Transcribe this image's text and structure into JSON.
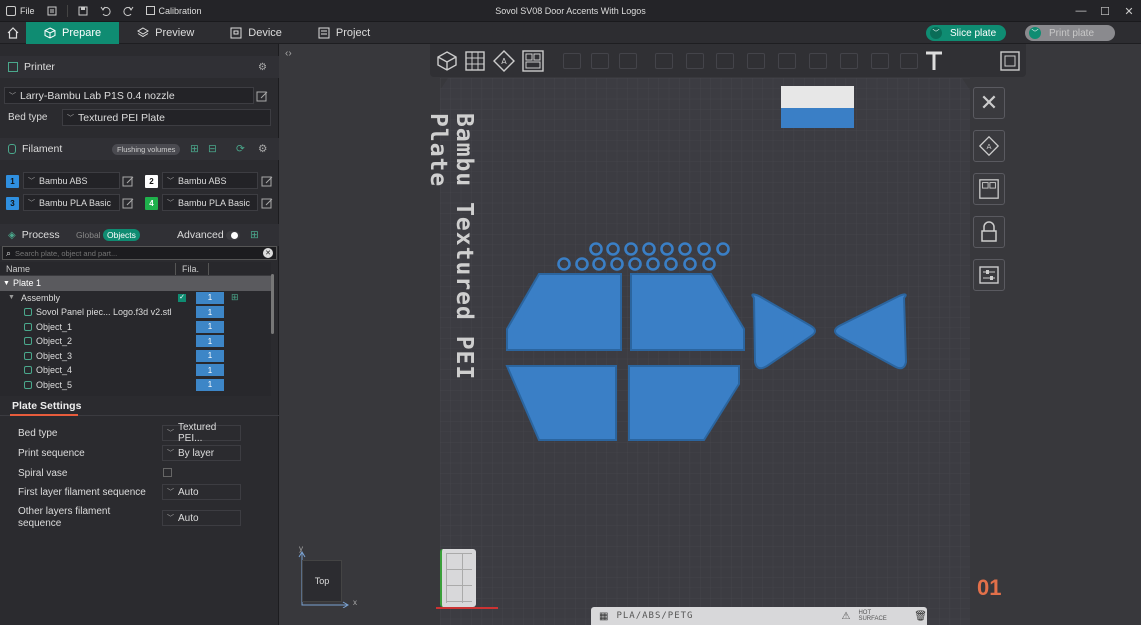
{
  "titlebar": {
    "file_label": "File",
    "calibration_label": "Calibration",
    "window_title": "Sovol SV08 Door Accents With Logos"
  },
  "nav": {
    "tabs": [
      {
        "label": "Prepare"
      },
      {
        "label": "Preview"
      },
      {
        "label": "Device"
      },
      {
        "label": "Project"
      }
    ],
    "slice_label": "Slice plate",
    "print_label": "Print plate"
  },
  "printer": {
    "header": "Printer",
    "profile": "Larry-Bambu Lab P1S 0.4 nozzle",
    "bed_type_label": "Bed type",
    "bed_type_value": "Textured PEI Plate"
  },
  "filament": {
    "header": "Filament",
    "flush_label": "Flushing volumes",
    "items": [
      {
        "num": "1",
        "name": "Bambu ABS",
        "color": "#2f8fdf"
      },
      {
        "num": "2",
        "name": "Bambu ABS",
        "color": "#ffffff"
      },
      {
        "num": "3",
        "name": "Bambu PLA Basic",
        "color": "#2f8fdf"
      },
      {
        "num": "4",
        "name": "Bambu PLA Basic",
        "color": "#1fb14c"
      }
    ]
  },
  "process": {
    "header": "Process",
    "global_label": "Global",
    "objects_label": "Objects",
    "advanced_label": "Advanced",
    "search_placeholder": "Search plate, object and part..."
  },
  "tree": {
    "col_name": "Name",
    "col_fila": "Fila.",
    "plate": "Plate 1",
    "assembly": "Assembly",
    "assembly_fila": "1",
    "objects": [
      {
        "name": "Sovol Panel piec... Logo.f3d v2.stl",
        "fila": "1"
      },
      {
        "name": "Object_1",
        "fila": "1"
      },
      {
        "name": "Object_2",
        "fila": "1"
      },
      {
        "name": "Object_3",
        "fila": "1"
      },
      {
        "name": "Object_4",
        "fila": "1"
      },
      {
        "name": "Object_5",
        "fila": "1"
      }
    ]
  },
  "plate_settings": {
    "tab": "Plate Settings",
    "bed_type_label": "Bed type",
    "bed_type_value": "Textured PEI...",
    "print_seq_label": "Print sequence",
    "print_seq_value": "By layer",
    "spiral_label": "Spiral vase",
    "first_layer_label": "First layer filament sequence",
    "first_layer_value": "Auto",
    "other_layers_label": "Other layers filament sequence",
    "other_layers_value": "Auto"
  },
  "viewport": {
    "plate_text": "Bambu Textured PEI Plate",
    "plate_number": "01",
    "view_label": "Top",
    "axis_x": "x",
    "axis_y": "y",
    "bottom_material": "PLA/ABS/PETG",
    "bottom_surface": "HOT SURFACE",
    "part_color": "#3a7fc6",
    "accent_color": "#0f8c72"
  }
}
